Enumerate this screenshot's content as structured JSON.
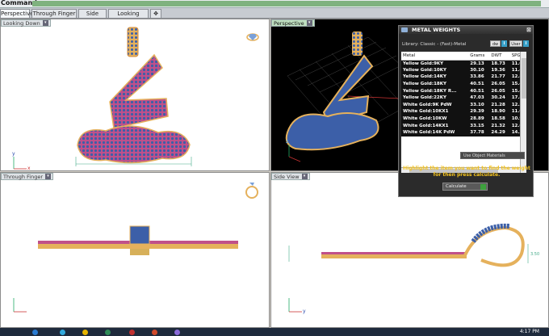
{
  "command": {
    "label": "Command:"
  },
  "tabs": [
    {
      "label": "Perspective",
      "active": true
    },
    {
      "label": "Through Finger"
    },
    {
      "label": "Side View"
    },
    {
      "label": "Looking Down"
    }
  ],
  "viewports": {
    "top_left": {
      "label": "Looking Down"
    },
    "top_right": {
      "label": "Perspective"
    },
    "bottom_left": {
      "label": "Through Finger"
    },
    "bottom_right": {
      "label": "Side View"
    }
  },
  "dimensions": {
    "side_height": "3.50"
  },
  "metal_weights": {
    "title": "METAL WEIGHTS",
    "library": "Library: Classic - (Fast)-Metal",
    "units_btn": "dw",
    "user_btn": "User",
    "columns": [
      "Metal",
      "Grams",
      "DWT",
      "SPG"
    ],
    "rows": [
      [
        "Yellow Gold:9KY",
        "29.13",
        "18.73",
        "11.05"
      ],
      [
        "Yellow Gold:10KY",
        "30.10",
        "19.36",
        "11.47"
      ],
      [
        "Yellow Gold:14KY",
        "33.86",
        "21.77",
        "12.88"
      ],
      [
        "Yellow Gold:18KY",
        "40.51",
        "26.05",
        "15.48"
      ],
      [
        "Yellow Gold:18KY R...",
        "40.51",
        "26.05",
        "15.48"
      ],
      [
        "Yellow Gold:22KY",
        "47.03",
        "30.24",
        "17.86"
      ],
      [
        "White Gold:9K PdW",
        "33.10",
        "21.28",
        "12.59"
      ],
      [
        "White Gold:10KX1",
        "29.39",
        "18.90",
        "11.00"
      ],
      [
        "White Gold:10KW",
        "28.89",
        "18.58",
        "10.95"
      ],
      [
        "White Gold:14KX1",
        "33.15",
        "21.32",
        "12.67"
      ],
      [
        "White Gold:14K PdW",
        "37.78",
        "24.29",
        "14.37"
      ]
    ],
    "use_object": "Use Object Materials",
    "hint": "Highlight the item you want to find the weight for then press calculate.",
    "calculate": "Calculate"
  },
  "taskbar": {
    "time": "4:17 PM"
  },
  "colors": {
    "gold": "#e5b15c",
    "pink": "#c0508a",
    "stone": "#3c5fa8"
  }
}
